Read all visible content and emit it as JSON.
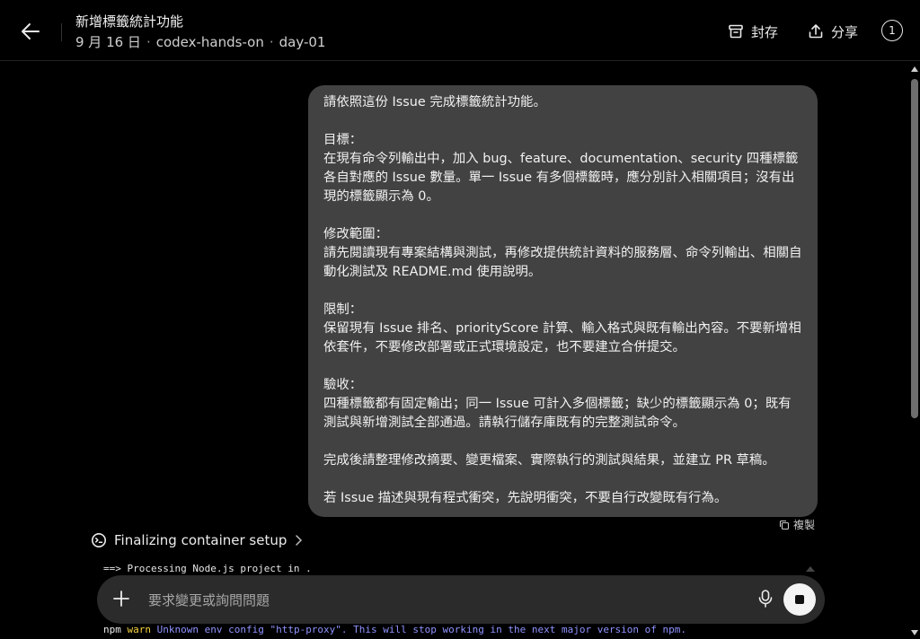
{
  "header": {
    "title": "新增標籤統計功能",
    "date": "9 月 16 日",
    "repo": "codex-hands-on",
    "branch": "day-01",
    "separator": "·",
    "archive_label": "封存",
    "share_label": "分享",
    "count": "1"
  },
  "message": {
    "paragraphs": [
      "請依照這份 Issue 完成標籤統計功能。",
      "目標：\n在現有命令列輸出中，加入 bug、feature、documentation、security 四種標籤各自對應的 Issue 數量。單一 Issue 有多個標籤時，應分別計入相關項目；沒有出現的標籤顯示為 0。",
      "修改範圍：\n請先閱讀現有專案結構與測試，再修改提供統計資料的服務層、命令列輸出、相關自動化測試及 README.md 使用說明。",
      "限制：\n保留現有 Issue 排名、priorityScore 計算、輸入格式與既有輸出內容。不要新增相依套件，不要修改部署或正式環境設定，也不要建立合併提交。",
      "驗收：\n四種標籤都有固定輸出；同一 Issue 可計入多個標籤；缺少的標籤顯示為 0；既有測試與新增測試全部通過。請執行儲存庫既有的完整測試命令。",
      "完成後請整理修改摘要、變更檔案、實際執行的測試與結果，並建立 PR 草稿。",
      "若 Issue 描述與現有程式衝突，先說明衝突，不要自行改變既有行為。"
    ],
    "copy_label": "複製"
  },
  "status": {
    "label": "Finalizing container setup"
  },
  "log": {
    "line1": "==> Processing Node.js project in .",
    "line2_prefix": "npm",
    "line2_level": "warn",
    "line2_text": "Unknown env config \"http-proxy\". This will stop working in the next major version of npm."
  },
  "composer": {
    "placeholder": "要求變更或詢問問題"
  },
  "colors": {
    "background": "#000000",
    "bubble": "#424242",
    "composer": "#2b2b2b",
    "warn": "#f5d440",
    "log_message": "#8f93ff"
  }
}
